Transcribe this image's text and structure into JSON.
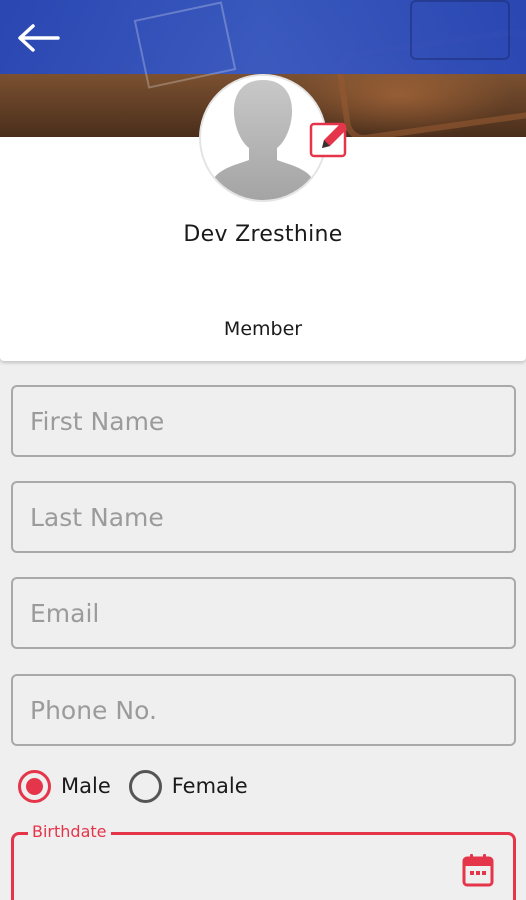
{
  "header": {
    "back_icon": "arrow-left-icon"
  },
  "profile": {
    "name": "Dev Zresthine",
    "role": "Member",
    "avatar_icon": "user-silhouette-icon",
    "edit_icon": "edit-pencil-icon"
  },
  "form": {
    "first_name_placeholder": "First Name",
    "last_name_placeholder": "Last Name",
    "email_placeholder": "Email",
    "phone_placeholder": "Phone No.",
    "gender": {
      "male_label": "Male",
      "female_label": "Female",
      "selected": "Male"
    },
    "birthdate_label": "Birthdate",
    "birthdate_value": "",
    "calendar_icon": "calendar-icon"
  },
  "colors": {
    "accent": "#e5354a",
    "header_blue": "#2648be",
    "background": "#efefef"
  }
}
